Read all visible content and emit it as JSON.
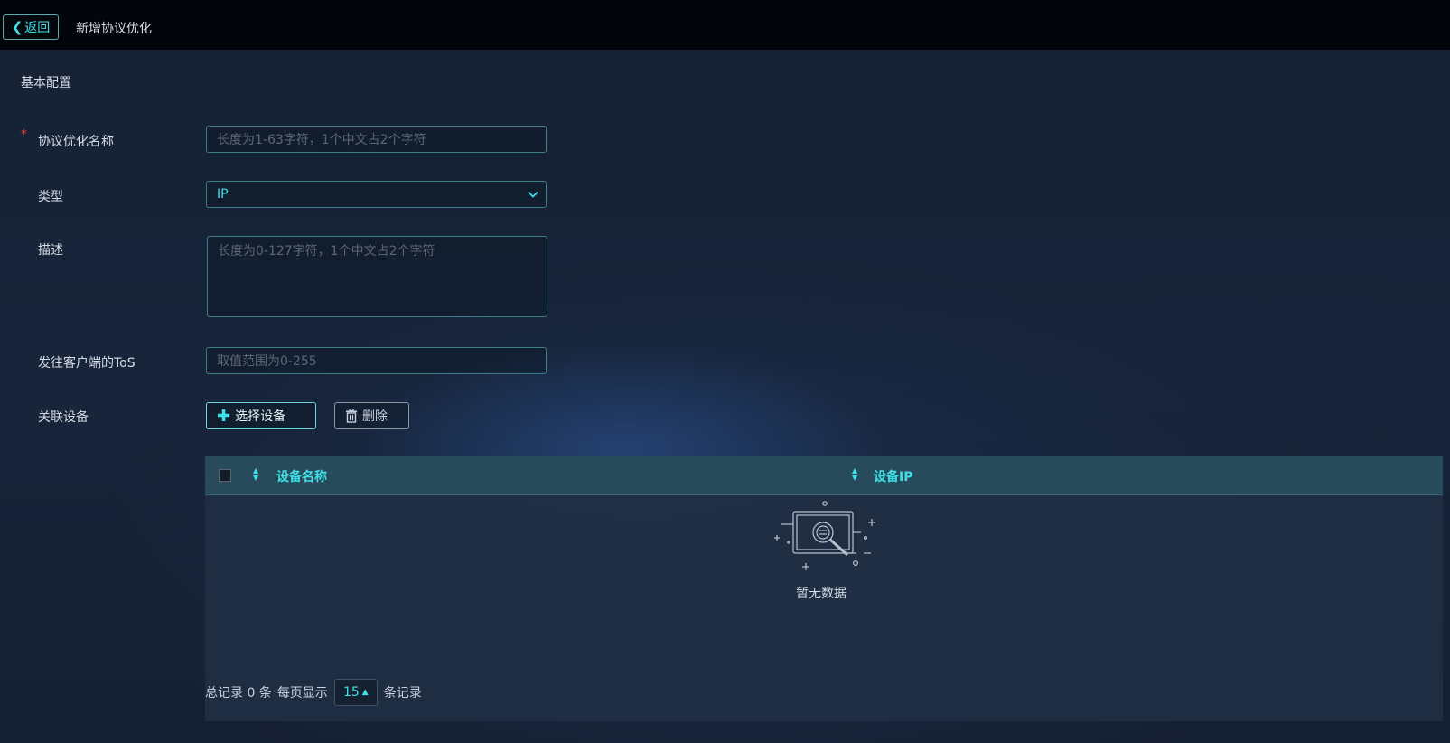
{
  "header": {
    "back_label": "返回",
    "page_title": "新增协议优化"
  },
  "form": {
    "section_title": "基本配置",
    "name": {
      "label": "协议优化名称",
      "required_mark": "*",
      "placeholder": "长度为1-63字符，1个中文占2个字符"
    },
    "type": {
      "label": "类型",
      "value": "IP"
    },
    "description": {
      "label": "描述",
      "placeholder": "长度为0-127字符，1个中文占2个字符"
    },
    "tos": {
      "label": "发往客户端的ToS",
      "placeholder": "取值范围为0-255"
    },
    "devices": {
      "label": "关联设备",
      "select_button": "选择设备",
      "delete_button": "删除"
    }
  },
  "table": {
    "columns": [
      "设备名称",
      "设备IP"
    ],
    "rows": [],
    "empty_text": "暂无数据"
  },
  "pagination": {
    "total_text": "总记录 0 条",
    "per_page_prefix": "每页显示",
    "page_size": "15",
    "per_page_suffix": "条记录"
  },
  "icons": {
    "back": "chevron-left-icon",
    "dropdown": "chevron-down-icon",
    "add": "plus-icon",
    "delete": "trash-icon",
    "sort": "sort-icon",
    "empty": "empty-data-icon"
  },
  "colors": {
    "accent": "#3fe0e8",
    "required": "#e23b3b",
    "table_header": "#274b5a"
  }
}
